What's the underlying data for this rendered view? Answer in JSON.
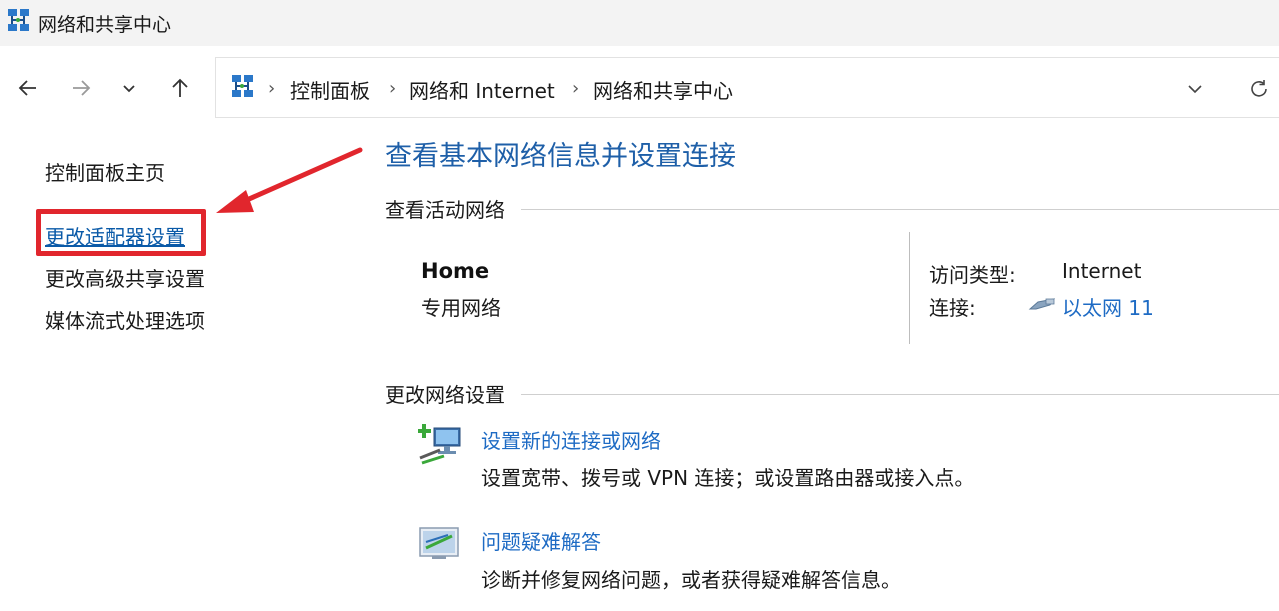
{
  "window": {
    "title": "网络和共享中心"
  },
  "toolbar": {
    "back_icon": "arrow-left-icon",
    "forward_icon": "arrow-right-icon",
    "recent_icon": "chevron-down-icon",
    "up_icon": "arrow-up-icon"
  },
  "address": {
    "crumbs": [
      "控制面板",
      "网络和 Internet",
      "网络和共享中心"
    ],
    "separator": "›",
    "dropdown_icon": "chevron-down-icon",
    "refresh_icon": "refresh-icon"
  },
  "sidebar": {
    "items": [
      {
        "label": "控制面板主页"
      },
      {
        "label": "更改适配器设置",
        "highlighted": true
      },
      {
        "label": "更改高级共享设置"
      },
      {
        "label": "媒体流式处理选项"
      }
    ],
    "highlight_color": "#e1262d"
  },
  "main": {
    "title": "查看基本网络信息并设置连接",
    "active_networks_header": "查看活动网络",
    "network": {
      "name": "Home",
      "type": "专用网络",
      "access_type_label": "访问类型:",
      "access_type_value": "Internet",
      "connections_label": "连接:",
      "connection_value": "以太网 11"
    },
    "change_settings_header": "更改网络设置",
    "tasks": [
      {
        "title": "设置新的连接或网络",
        "desc": "设置宽带、拨号或 VPN 连接；或设置路由器或接入点。",
        "icon": "new-connection-icon"
      },
      {
        "title": "问题疑难解答",
        "desc": "诊断并修复网络问题，或者获得疑难解答信息。",
        "icon": "troubleshoot-icon"
      }
    ]
  },
  "colors": {
    "link": "#1e6bc4",
    "title": "#1e5fa8",
    "annotation": "#e1262d"
  }
}
